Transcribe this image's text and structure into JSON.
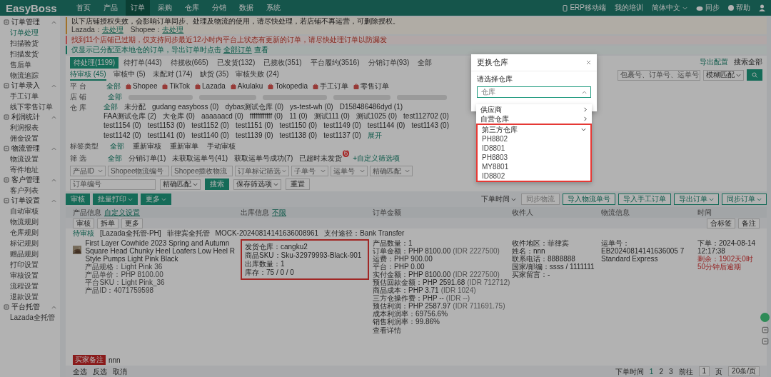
{
  "top_nav": {
    "logo": "EasyBoss",
    "menu": [
      {
        "label": "首页",
        "selected": false
      },
      {
        "label": "产品",
        "selected": false
      },
      {
        "label": "订单",
        "selected": true
      },
      {
        "label": "采购",
        "selected": false
      },
      {
        "label": "仓库",
        "selected": false
      },
      {
        "label": "分销",
        "selected": false
      },
      {
        "label": "数据",
        "selected": false
      },
      {
        "label": "系统",
        "selected": false
      }
    ],
    "right": [
      {
        "kind": "phone",
        "label": "ERP移动端"
      },
      {
        "kind": "none",
        "label": "我的培训"
      },
      {
        "kind": "lang",
        "label": "简体中文"
      },
      {
        "kind": "cloud",
        "label": "同步"
      },
      {
        "kind": "help",
        "label": "帮助"
      },
      {
        "kind": "user"
      }
    ]
  },
  "sidebar": [
    {
      "label": "订单管理",
      "expanded": true,
      "items": [
        {
          "label": "订单处理",
          "selected": true
        },
        {
          "label": "扫描验货",
          "selected": false
        },
        {
          "label": "扫描发货",
          "selected": false
        },
        {
          "label": "售后单",
          "selected": false
        },
        {
          "label": "物流追踪",
          "selected": false
        }
      ]
    },
    {
      "label": "订单录入",
      "expanded": true,
      "items": [
        {
          "label": "手工订单",
          "selected": false
        },
        {
          "label": "线下零售订单",
          "selected": false
        }
      ]
    },
    {
      "label": "利润统计",
      "expanded": true,
      "items": [
        {
          "label": "利润报表",
          "selected": false
        },
        {
          "label": "佣金设置",
          "selected": false
        }
      ]
    },
    {
      "label": "物流管理",
      "expanded": true,
      "items": [
        {
          "label": "物流设置",
          "selected": false
        },
        {
          "label": "寄件地址",
          "selected": false
        }
      ]
    },
    {
      "label": "客户管理",
      "expanded": true,
      "items": [
        {
          "label": "客户列表",
          "selected": false
        }
      ]
    },
    {
      "label": "订单设置",
      "expanded": true,
      "items": [
        {
          "label": "自动审核",
          "selected": false
        },
        {
          "label": "物流规则",
          "selected": false
        },
        {
          "label": "仓库规则",
          "selected": false
        },
        {
          "label": "标记规则",
          "selected": false
        },
        {
          "label": "赠品规则",
          "selected": false
        },
        {
          "label": "打印设置",
          "selected": false
        },
        {
          "label": "审核设置",
          "selected": false
        },
        {
          "label": "流程设置",
          "selected": false
        },
        {
          "label": "退款设置",
          "selected": false
        }
      ]
    },
    {
      "label": "平台托管",
      "expanded": true,
      "items": [
        {
          "label": "Lazada全托管",
          "selected": false
        }
      ]
    }
  ],
  "notices": [
    {
      "kind": "warning",
      "text": "以下店铺授权失效，会影响订单同步、处理及物流的使用，请尽快处理，若店铺不再运营，可删除授权。",
      "links": [
        {
          "label": "Lazada：",
          "action": "去处理"
        },
        {
          "label": "Shopee：",
          "action": "去处理"
        }
      ]
    },
    {
      "kind": "error",
      "text": "找到11个店铺已过期，仅支持同步最近12小时内平台上状态有更新的订单，请尽快处理订单以防漏发"
    },
    {
      "kind": "info",
      "text": "仅显示已分配至本地仓的订单，导出订单时点击",
      "link": "全部订单",
      "tail": "查看"
    }
  ],
  "status_tabs": [
    {
      "label": "待处理(1199)",
      "selected": true
    },
    {
      "label": "待打单(443)",
      "selected": false
    },
    {
      "label": "待揽收(665)",
      "selected": false
    },
    {
      "label": "已发货(132)",
      "selected": false
    },
    {
      "label": "已揽收(351)",
      "selected": false
    },
    {
      "label": "平台履约(3516)",
      "selected": false
    },
    {
      "label": "分销订单(93)",
      "selected": false
    },
    {
      "label": "全部",
      "selected": false
    }
  ],
  "header_search": {
    "config": "导出配置",
    "label": "搜索全部",
    "placeholder": "包裹号、订单号、运单号",
    "match": "模糊匹配"
  },
  "sub_tabs": [
    {
      "label": "待审核 (45)",
      "selected": true
    },
    {
      "label": "审核中 (5)",
      "selected": false
    },
    {
      "label": "未配对 (174)",
      "selected": false
    },
    {
      "label": "缺货 (35)",
      "selected": false
    },
    {
      "label": "审核失败 (24)",
      "selected": false
    }
  ],
  "platform_filter": {
    "label": "平 台",
    "options": [
      {
        "label": "全部",
        "selected": true
      },
      {
        "label": "Shopee",
        "selected": false,
        "kind": "platform"
      },
      {
        "label": "TikTok",
        "selected": false,
        "kind": "platform"
      },
      {
        "label": "Lazada",
        "selected": false,
        "kind": "platform"
      },
      {
        "label": "Akulaku",
        "selected": false,
        "kind": "platform"
      },
      {
        "label": "Tokopedia",
        "selected": false,
        "kind": "platform"
      },
      {
        "label": "手工订单",
        "selected": false,
        "kind": "platform"
      },
      {
        "label": "零售订单",
        "selected": false,
        "kind": "platform"
      }
    ]
  },
  "shop_filter": {
    "label": "店 铺",
    "options": [
      {
        "label": "全部",
        "selected": true
      }
    ]
  },
  "warehouse_filter": {
    "label": "仓 库",
    "expand": "展开",
    "options": [
      {
        "label": "全部",
        "selected": true
      },
      {
        "label": "未分配",
        "selected": false
      },
      {
        "label": "gudang easyboss (0)",
        "selected": false
      },
      {
        "label": "dybas测试仓库 (0)",
        "selected": false
      },
      {
        "label": "ys-test-wh (0)",
        "selected": false
      },
      {
        "label": "D158486486dyd (1)",
        "selected": false
      },
      {
        "label": "FAA测试仓库 (2)",
        "selected": false
      },
      {
        "label": "大仓库 (0)",
        "selected": false
      },
      {
        "label": "aaaaaacd (0)",
        "selected": false
      },
      {
        "label": "ffffffffffff (0)",
        "selected": false
      },
      {
        "label": "11 (0)",
        "selected": false
      },
      {
        "label": "测试111 (0)",
        "selected": false
      },
      {
        "label": "测试1025 (0)",
        "selected": false
      },
      {
        "label": "test112702 (0)",
        "selected": false
      },
      {
        "label": "test1154 (0)",
        "selected": false
      },
      {
        "label": "test1153 (0)",
        "selected": false
      },
      {
        "label": "test1152 (0)",
        "selected": false
      },
      {
        "label": "test1151 (0)",
        "selected": false
      },
      {
        "label": "test1150 (0)",
        "selected": false
      },
      {
        "label": "test1149 (0)",
        "selected": false
      },
      {
        "label": "test1144 (0)",
        "selected": false
      },
      {
        "label": "test1143 (0)",
        "selected": false
      },
      {
        "label": "test1142 (0)",
        "selected": false
      },
      {
        "label": "test1141 (0)",
        "selected": false
      },
      {
        "label": "test1140 (0)",
        "selected": false
      },
      {
        "label": "test1139 (0)",
        "selected": false
      },
      {
        "label": "test1138 (0)",
        "selected": false
      },
      {
        "label": "test1137 (0)",
        "selected": false
      }
    ]
  },
  "tag_filter": {
    "label": "标签类型",
    "options": [
      {
        "label": "全部",
        "selected": true
      },
      {
        "label": "重新审核",
        "selected": false
      },
      {
        "label": "重新审单",
        "selected": false
      },
      {
        "label": "手动审核",
        "selected": false
      }
    ]
  },
  "custom_filter": {
    "label": "筛 选",
    "add": "+自定义筛选项",
    "options": [
      {
        "label": "全部",
        "selected": true
      },
      {
        "label": "分销订单(1)",
        "selected": false
      },
      {
        "label": "未获取运单号(41)",
        "selected": false
      },
      {
        "label": "获取运单号成功(7)",
        "selected": false
      },
      {
        "label": "已超时未发货",
        "selected": false,
        "badge": "6"
      }
    ]
  },
  "search_fields": {
    "row1": [
      {
        "placeholder": "产品ID"
      },
      {
        "placeholder": "Shopee物流编号"
      },
      {
        "placeholder": "Shopee揽收物流"
      },
      {
        "placeholder": "订单标记筛选"
      },
      {
        "placeholder": "子单号"
      },
      {
        "placeholder": "运单号"
      },
      {
        "placeholder": "精确匹配"
      }
    ],
    "row2": {
      "placeholder": "订单编号",
      "match": "精确匹配",
      "search": "搜索",
      "save": "保存筛选项",
      "reset": "重置"
    }
  },
  "toolbar": {
    "left": [
      {
        "label": "审核",
        "dropdown": false
      },
      {
        "label": "批量打印",
        "dropdown": true
      },
      {
        "label": "更多",
        "dropdown": true
      }
    ],
    "sort": "下单时间",
    "right": [
      {
        "label": "同步物流",
        "disabled": true,
        "dropdown": false
      },
      {
        "label": "导入物流单号",
        "disabled": false,
        "dropdown": false
      },
      {
        "label": "导入手工订单",
        "disabled": false,
        "dropdown": false
      },
      {
        "label": "导出订单",
        "disabled": false,
        "dropdown": true
      },
      {
        "label": "同步订单",
        "disabled": false,
        "dropdown": true
      }
    ]
  },
  "table": {
    "columns": [
      {
        "label": "产品信息",
        "extra": "自定义设置"
      },
      {
        "label": "出库信息",
        "extra": "不限"
      },
      {
        "label": "订单金额"
      },
      {
        "label": "收件人"
      },
      {
        "label": "物流信息"
      },
      {
        "label": "时间"
      }
    ],
    "bulk_actions": [
      "审核",
      "拆单",
      "更多"
    ],
    "tag_actions": [
      "合标签",
      "备注"
    ],
    "order": {
      "status": "待审核",
      "shop": "[Lazada全托管-PH]",
      "site": "菲律宾全托管",
      "order_no": "MOCK-20240814141636008961",
      "pay_label": "支付途径：",
      "pay": "Bank Transfer",
      "product": {
        "title": "First Layer Cowhide 2023 Spring and Autumn Square Head Chunky Heel Loafers Low Heel R Style Pumps Light Pink Black",
        "attrs": [
          {
            "label": "产品规格：",
            "value": "Light Pink 36"
          },
          {
            "label": "产品单价：",
            "value": "PHP 8100.00"
          },
          {
            "label": "平台SKU：",
            "value": "Light Pink_36"
          },
          {
            "label": "产品ID：",
            "value": "4071759598"
          }
        ]
      },
      "outbound": [
        {
          "label": "发货仓库：",
          "value": "cangku2"
        },
        {
          "label": "商品SKU：",
          "value": "Sku-32979993-Black-901"
        },
        {
          "label": "出库数量：",
          "value": "1"
        },
        {
          "label": "库存：",
          "value": "75 / 0 / 0"
        }
      ],
      "amounts": [
        {
          "label": "产品数量：",
          "value": "1"
        },
        {
          "label": "订单金额：",
          "value": "PHP 8100.00",
          "sub": "(IDR 2227500)"
        },
        {
          "label": "运费：",
          "value": "PHP 900.00"
        },
        {
          "label": "平台：",
          "value": "PHP 0.00"
        },
        {
          "label": "实付金额：",
          "value": "PHP 8100.00",
          "sub": "(IDR 2227500)"
        },
        {
          "label": "预估回款金额：",
          "value": "PHP 2591.68",
          "sub": "(IDR 712712)"
        },
        {
          "label": "商品成本：",
          "value": "PHP 3.71",
          "sub": "(IDR 1024)"
        },
        {
          "label": "三方仓操作费：",
          "value": "PHP --",
          "sub": "(IDR --)"
        },
        {
          "label": "预估利润：",
          "value": "PHP 2587.97",
          "sub": "(IDR 711691.75)"
        },
        {
          "label": "成本利润率：",
          "value": "69756.6%"
        },
        {
          "label": "销售利润率：",
          "value": "99.86%"
        }
      ],
      "amount_link": "查看详情",
      "recipient": [
        {
          "label": "收件地区：",
          "value": "菲律宾"
        },
        {
          "label": "姓名：",
          "value": "nnn"
        },
        {
          "label": "联系电话：",
          "value": "8888888"
        },
        {
          "label": "国家/邮编：",
          "value": "ssss / 1111111"
        },
        {
          "label": "买家留言：",
          "value": "-"
        }
      ],
      "logistics": [
        "运单号：",
        "EB20240814141636005 7",
        "Standard Express"
      ],
      "times": [
        {
          "label": "下单：",
          "value": "2024-08-14 12:17:38",
          "alert": false
        },
        {
          "label": "剩余：",
          "value": "1902天0时50分钟后逾期",
          "alert": true
        }
      ],
      "note_tag": "买家备注",
      "note": "nnn"
    },
    "footer_actions": [
      "全选",
      "反选",
      "取消"
    ],
    "pagination": {
      "sort": "下单时间",
      "pages": [
        {
          "label": "1",
          "selected": true
        },
        {
          "label": "2",
          "selected": false
        },
        {
          "label": "3",
          "selected": false
        }
      ],
      "goto": "前往",
      "page": "1",
      "unit": "页",
      "size": "20条/页"
    }
  },
  "modal": {
    "title": "更换仓库",
    "field_label": "请选择仓库",
    "placeholder": "仓库",
    "options": [
      {
        "label": "供应商",
        "expanded": false
      },
      {
        "label": "自营仓库",
        "expanded": false
      },
      {
        "label": "第三方仓库",
        "expanded": true,
        "children": [
          {
            "label": "PH8802"
          },
          {
            "label": "ID8801"
          },
          {
            "label": "PH8803"
          },
          {
            "label": "MY8801"
          },
          {
            "label": "ID8802"
          }
        ]
      }
    ]
  }
}
